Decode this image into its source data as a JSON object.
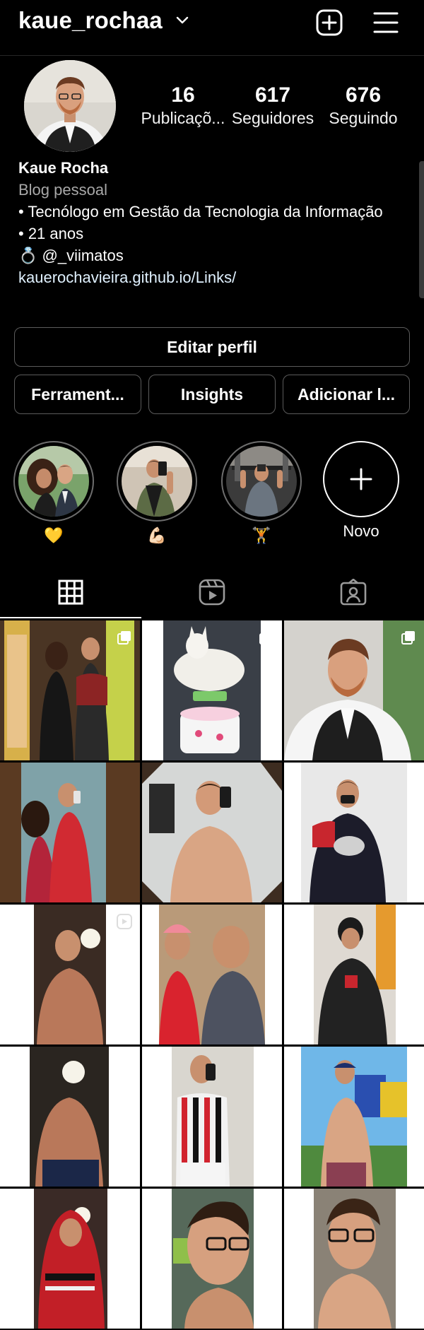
{
  "header": {
    "username": "kaue_rochaa"
  },
  "profile": {
    "stats": [
      {
        "value": "16",
        "label": "Publicaçõ..."
      },
      {
        "value": "617",
        "label": "Seguidores"
      },
      {
        "value": "676",
        "label": "Seguindo"
      }
    ],
    "name": "Kaue Rocha",
    "category": "Blog pessoal",
    "bio_lines": [
      "• Tecnólogo em Gestão da Tecnologia da Informação",
      "• 21 anos",
      "💍 @_viimatos"
    ],
    "link": "kauerochavieira.github.io/Links/"
  },
  "buttons": {
    "edit": "Editar perfil",
    "tools": "Ferrament...",
    "insights": "Insights",
    "add": "Adicionar l..."
  },
  "highlights": [
    {
      "label": "💛"
    },
    {
      "label": "💪🏻"
    },
    {
      "label": "🏋️"
    },
    {
      "label": "Novo"
    }
  ],
  "tabs": [
    "grid-icon",
    "reels-icon",
    "tagged-icon"
  ],
  "colors": {
    "background": "#000000",
    "secondary_text": "#a8a8a8",
    "border": "#5b5b5b"
  }
}
